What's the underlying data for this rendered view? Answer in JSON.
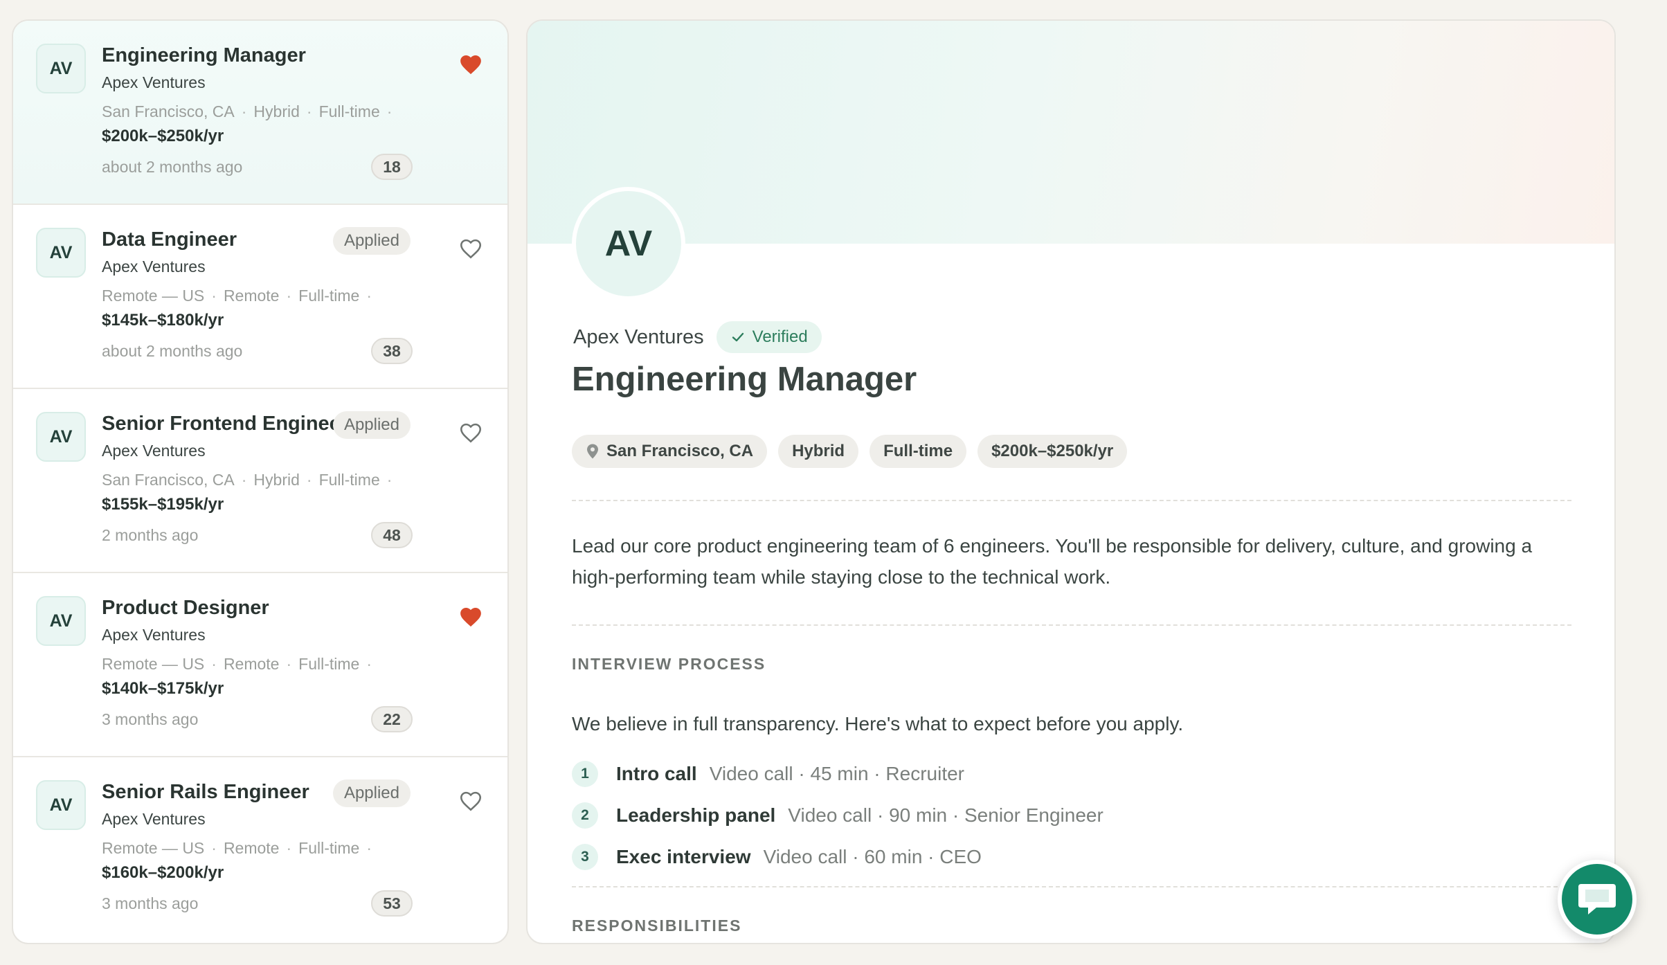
{
  "jobs": [
    {
      "title": "Engineering Manager",
      "company": "Apex Ventures",
      "logo": "AV",
      "location": "San Francisco, CA",
      "work_mode": "Hybrid",
      "type": "Full-time",
      "salary": "$200k–$250k/yr",
      "posted": "about 2 months ago",
      "count": "18",
      "applied": "",
      "saved": true,
      "selected": true
    },
    {
      "title": "Data Engineer",
      "company": "Apex Ventures",
      "logo": "AV",
      "location": "Remote — US",
      "work_mode": "Remote",
      "type": "Full-time",
      "salary": "$145k–$180k/yr",
      "posted": "about 2 months ago",
      "count": "38",
      "applied": "Applied",
      "saved": false,
      "selected": false
    },
    {
      "title": "Senior Frontend Engineer",
      "company": "Apex Ventures",
      "logo": "AV",
      "location": "San Francisco, CA",
      "work_mode": "Hybrid",
      "type": "Full-time",
      "salary": "$155k–$195k/yr",
      "posted": "2 months ago",
      "count": "48",
      "applied": "Applied",
      "saved": false,
      "selected": false
    },
    {
      "title": "Product Designer",
      "company": "Apex Ventures",
      "logo": "AV",
      "location": "Remote — US",
      "work_mode": "Remote",
      "type": "Full-time",
      "salary": "$140k–$175k/yr",
      "posted": "3 months ago",
      "count": "22",
      "applied": "",
      "saved": true,
      "selected": false
    },
    {
      "title": "Senior Rails Engineer",
      "company": "Apex Ventures",
      "logo": "AV",
      "location": "Remote — US",
      "work_mode": "Remote",
      "type": "Full-time",
      "salary": "$160k–$200k/yr",
      "posted": "3 months ago",
      "count": "53",
      "applied": "Applied",
      "saved": false,
      "selected": false
    }
  ],
  "detail": {
    "logo": "AV",
    "company": "Apex Ventures",
    "verified_label": "Verified",
    "title": "Engineering Manager",
    "chips": {
      "location": "San Francisco, CA",
      "work_mode": "Hybrid",
      "type": "Full-time",
      "salary": "$200k–$250k/yr"
    },
    "description": "Lead our core product engineering team of 6 engineers. You'll be responsible for delivery, culture, and growing a high-performing team while staying close to the technical work.",
    "interview": {
      "heading": "INTERVIEW PROCESS",
      "intro": "We believe in full transparency. Here's what to expect before you apply.",
      "steps": [
        {
          "num": "1",
          "name": "Intro call",
          "detail": "Video call · 45 min · Recruiter"
        },
        {
          "num": "2",
          "name": "Leadership panel",
          "detail": "Video call · 90 min · Senior Engineer"
        },
        {
          "num": "3",
          "name": "Exec interview",
          "detail": "Video call · 60 min · CEO"
        }
      ]
    },
    "responsibilities_heading": "RESPONSIBILITIES"
  },
  "icons": {
    "saved": "heart-filled-icon",
    "unsaved": "heart-outline-icon",
    "location": "map-pin-icon",
    "verified": "checkmark-icon",
    "chat": "chat-bubble-icon"
  },
  "colors": {
    "accent": "#138a6a",
    "heart": "#d94a2b",
    "verified_text": "#2c7d5c"
  }
}
